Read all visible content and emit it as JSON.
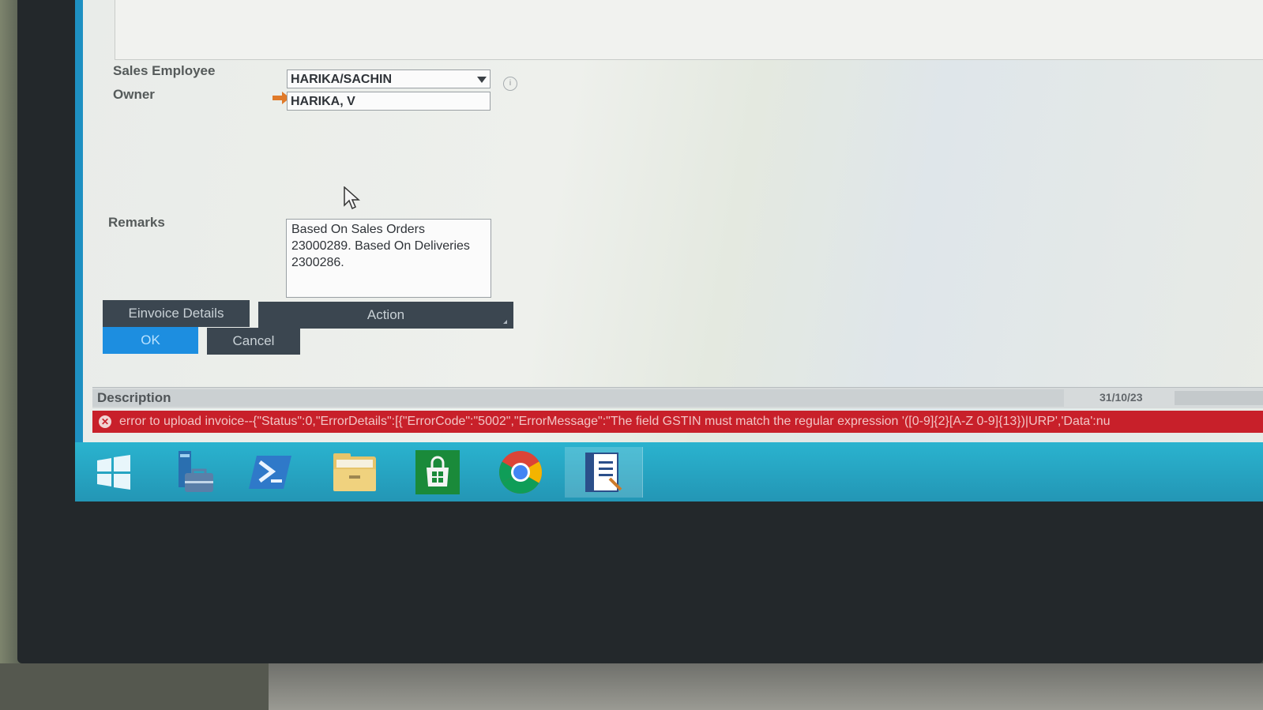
{
  "form": {
    "sales_employee_label": "Sales Employee",
    "sales_employee_value": "HARIKA/SACHIN",
    "owner_label": "Owner",
    "owner_value": "HARIKA, V",
    "remarks_label": "Remarks",
    "remarks_value": "Based On Sales Orders\n23000289. Based On Deliveries\n2300286."
  },
  "buttons": {
    "einvoice_details": "Einvoice Details",
    "action": "Action",
    "ok": "OK",
    "cancel": "Cancel"
  },
  "status": {
    "description_label": "Description",
    "date": "31/10/23",
    "error_message": "error to upload invoice--{\"Status\":0,\"ErrorDetails\":[{\"ErrorCode\":\"5002\",\"ErrorMessage\":\"The field GSTIN must match the regular expression '([0-9]{2}[A-Z 0-9]{13})|URP','Data':nu"
  },
  "taskbar": {
    "items": [
      "windows-start-icon",
      "server-manager-icon",
      "powershell-icon",
      "file-explorer-icon",
      "store-icon",
      "chrome-icon",
      "sap-business-one-icon"
    ]
  },
  "colors": {
    "error_bar": "#c8202a",
    "ok_button": "#1d8ee0",
    "dark_button": "#3b4650",
    "taskbar": "#2ab3cf"
  }
}
